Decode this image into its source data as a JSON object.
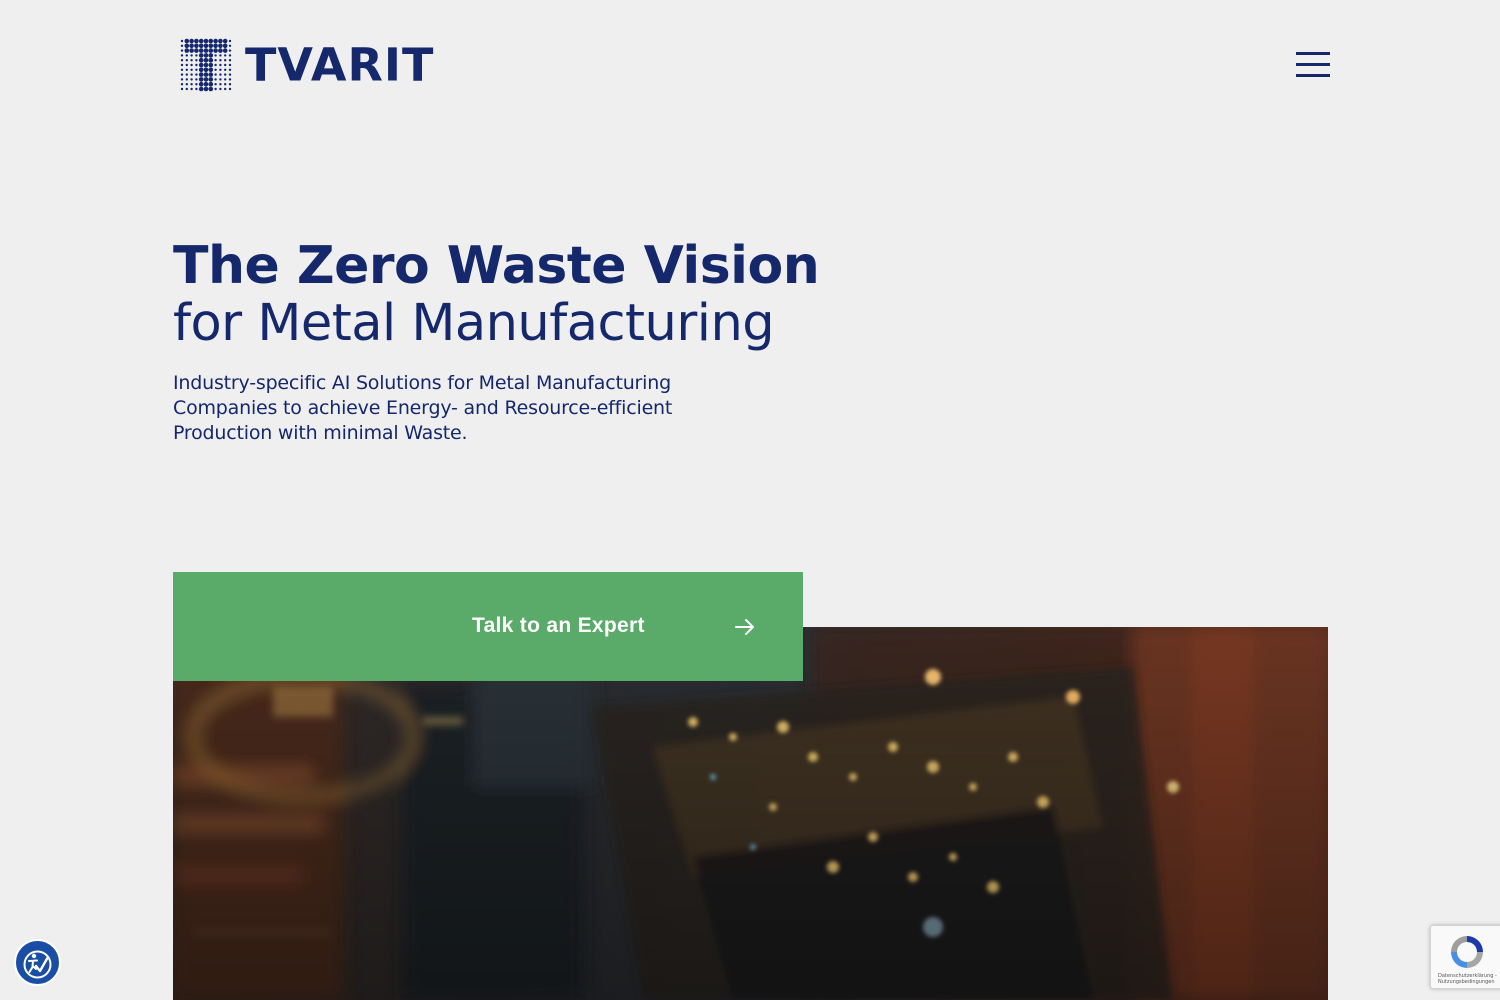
{
  "header": {
    "brand_name": "TVARIT",
    "menu_icon": "hamburger-menu-icon"
  },
  "hero": {
    "title_bold": "The Zero Waste Vision",
    "title_regular": "for Metal Manufacturing",
    "description": "Industry-specific AI Solutions for Metal Manufacturing Companies to achieve Energy- and Resource-efficient Production with minimal Waste.",
    "cta_label": "Talk to an Expert",
    "cta_icon": "arrow-right-icon"
  },
  "widgets": {
    "accessibility_icon": "accessibility-check-icon",
    "recaptcha_icon": "recaptcha-icon",
    "recaptcha_terms": "Datenschutzerklärung - Nutzungsbedingungen"
  },
  "colors": {
    "background": "#efefef",
    "brand_navy": "#14286b",
    "cta_green": "#5aab69",
    "accessibility_blue": "#1a4ea5"
  }
}
